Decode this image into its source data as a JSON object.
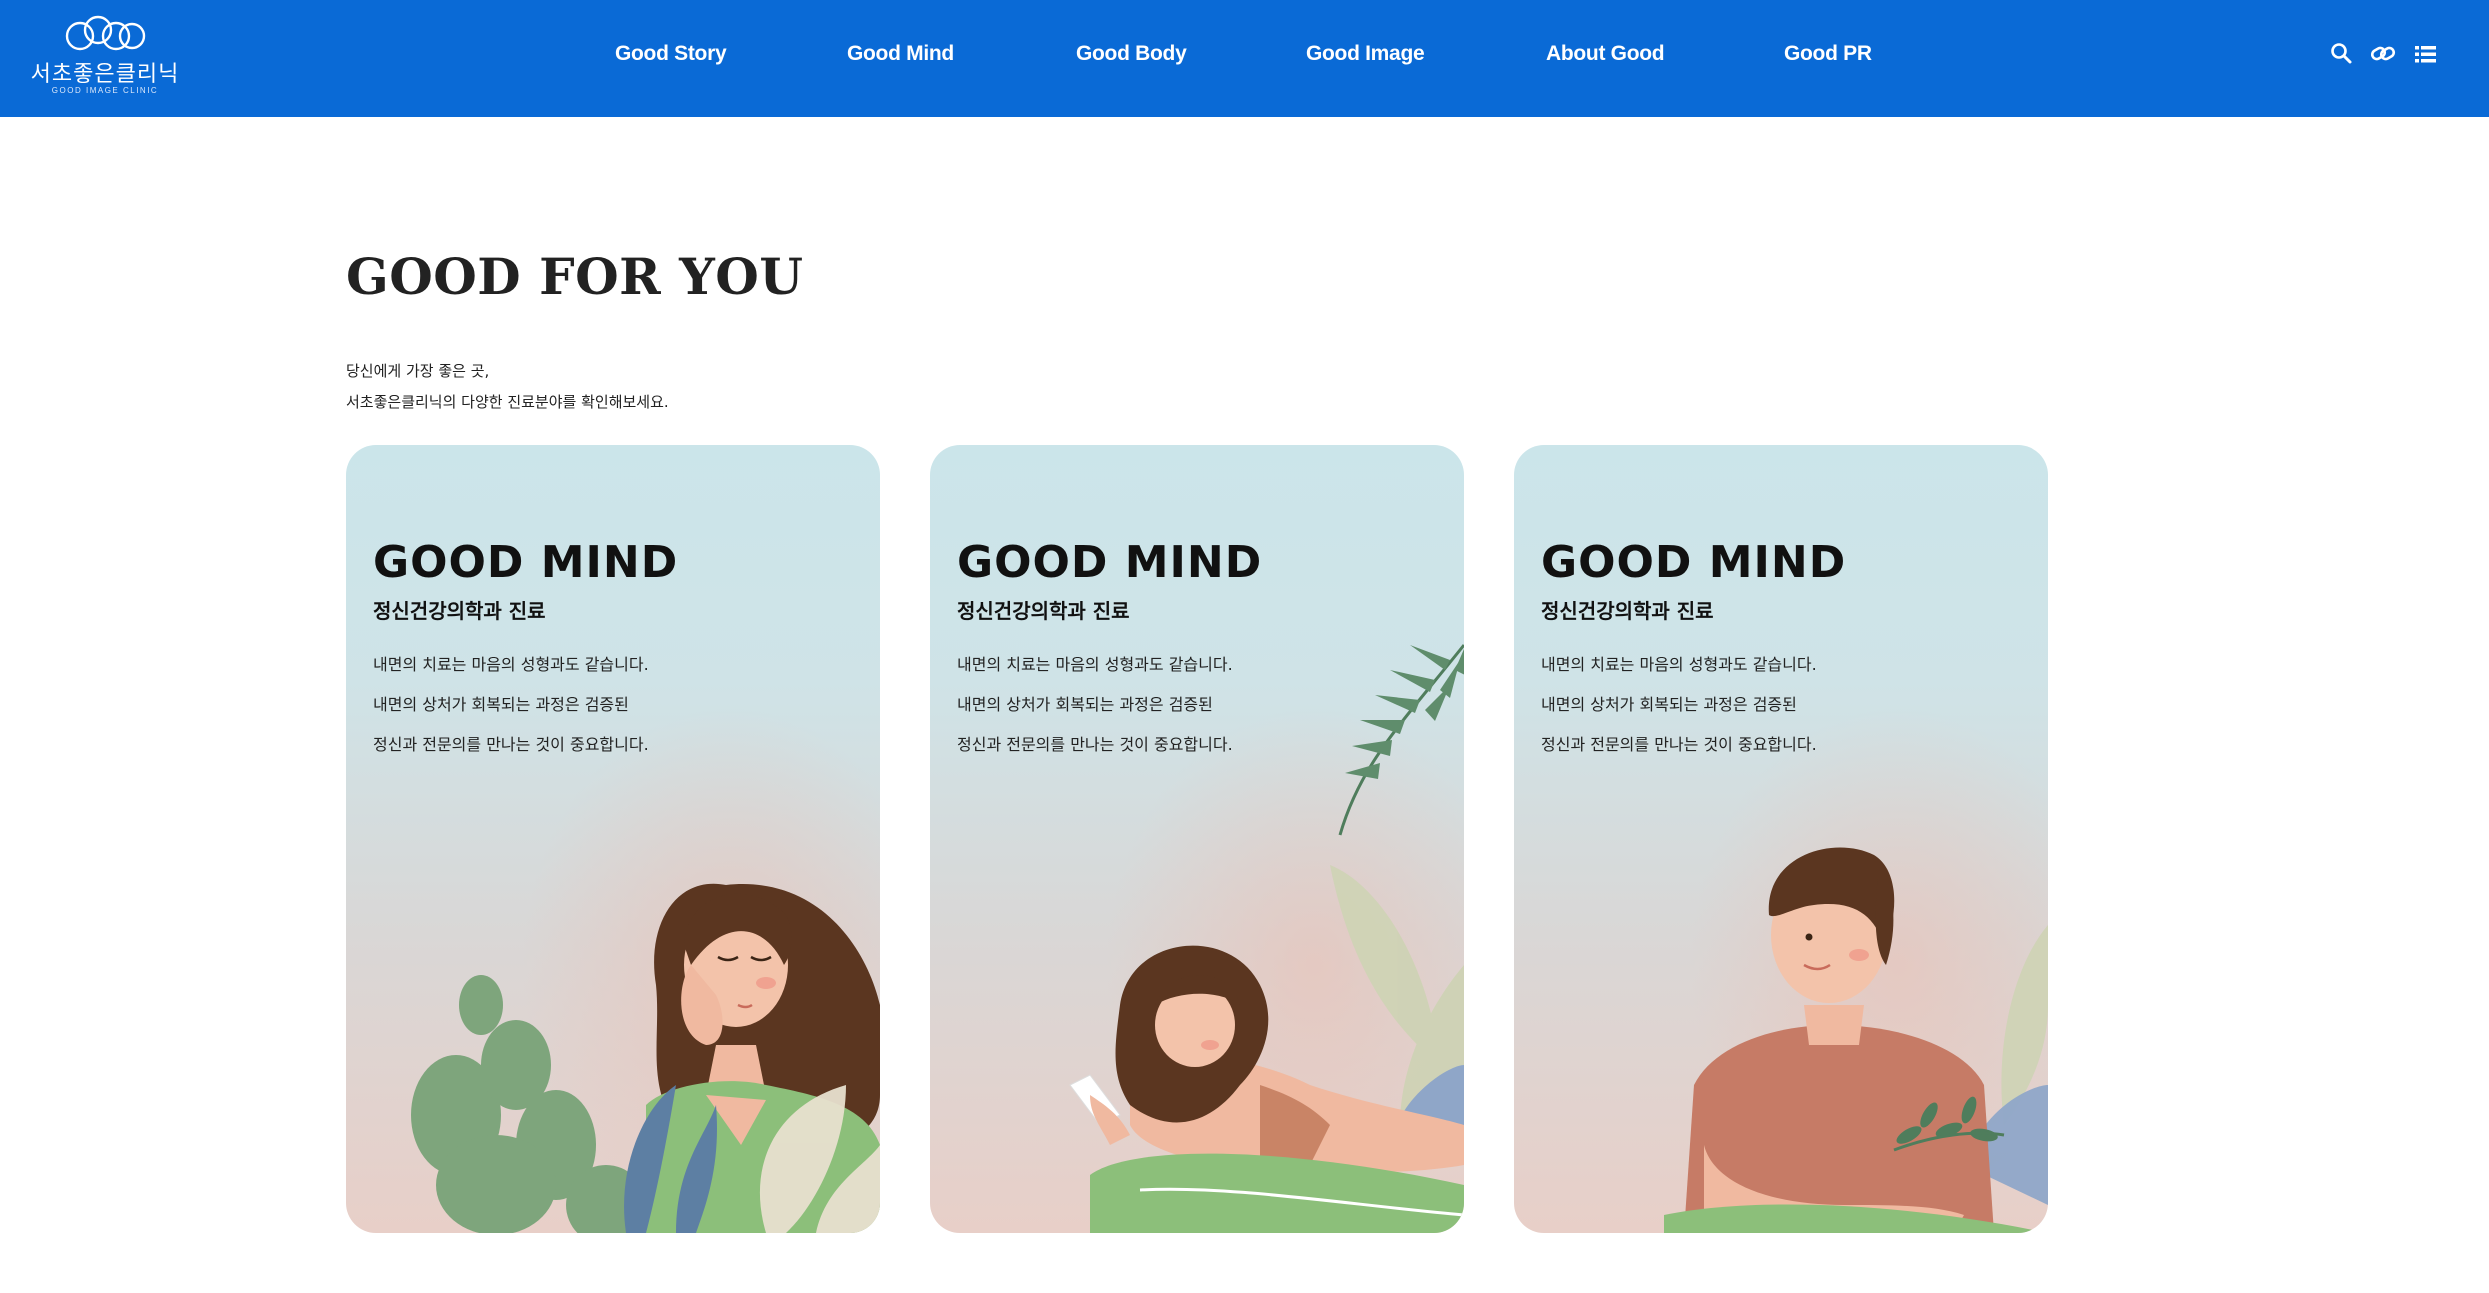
{
  "header": {
    "logo_ko": "서초좋은클리닉",
    "logo_en": "GOOD IMAGE CLINIC",
    "nav": [
      "Good Story",
      "Good Mind",
      "Good Body",
      "Good Image",
      "About Good",
      "Good PR"
    ],
    "icons": [
      "search-icon",
      "link-icon",
      "menu-list-icon"
    ],
    "background": "#0a6ad6"
  },
  "intro": {
    "title": "GOOD FOR YOU",
    "line1": "당신에게 가장 좋은 곳,",
    "line2": "서초좋은클리닉의 다양한 진료분야를 확인해보세요."
  },
  "cards": [
    {
      "title": "GOOD MIND",
      "subtitle": "정신건강의학과 진료",
      "desc": [
        "내면의 치료는 마음의 성형과도 같습니다.",
        "내면의 상처가 회복되는 과정은 검증된",
        "정신과 전문의를 만나는 것이 중요합니다."
      ],
      "illustration": "woman-resting-head-illustration"
    },
    {
      "title": "GOOD MIND",
      "subtitle": "정신건강의학과 진료",
      "desc": [
        "내면의 치료는 마음의 성형과도 같습니다.",
        "내면의 상처가 회복되는 과정은 검증된",
        "정신과 전문의를 만나는 것이 중요합니다."
      ],
      "illustration": "woman-lying-with-phone-illustration"
    },
    {
      "title": "GOOD MIND",
      "subtitle": "정신건강의학과 진료",
      "desc": [
        "내면의 치료는 마음의 성형과도 같습니다.",
        "내면의 상처가 회복되는 과정은 검증된",
        "정신과 전문의를 만나는 것이 중요합니다."
      ],
      "illustration": "man-smiling-illustration"
    }
  ]
}
